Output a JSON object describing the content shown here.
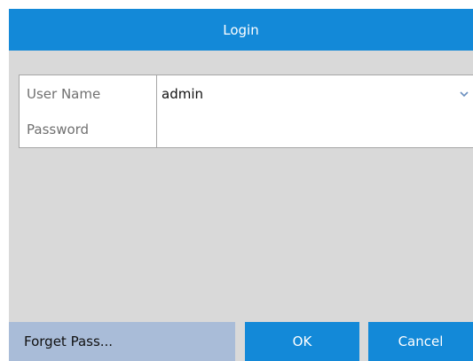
{
  "dialog": {
    "title": "Login"
  },
  "form": {
    "username_label": "User Name",
    "username_value": "admin",
    "password_label": "Password",
    "password_value": ""
  },
  "footer": {
    "forget_label": "Forget Pass...",
    "ok_label": "OK",
    "cancel_label": "Cancel"
  },
  "icons": {
    "username_dropdown": "chevron-down-icon"
  },
  "colors": {
    "accent": "#1389d8",
    "panel": "#d9d9d9",
    "forget_bg": "#a9bcd8"
  }
}
